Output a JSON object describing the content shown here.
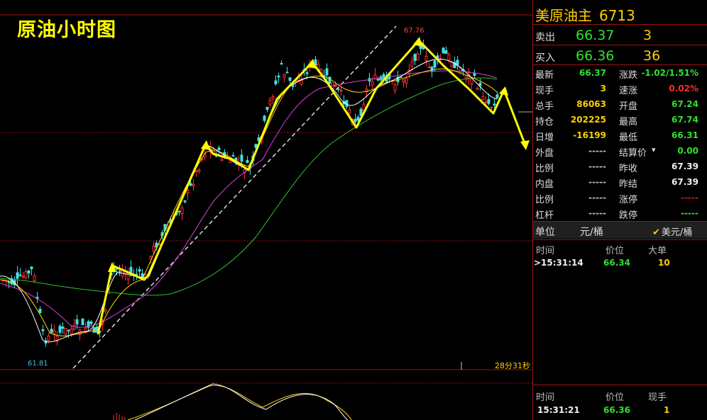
{
  "chart": {
    "title": "原油小时图",
    "high_label": "67.76",
    "low_label": "61.81",
    "countdown": "28分31秒"
  },
  "panel": {
    "name": "美原油主",
    "code": "6713",
    "sell": {
      "label": "卖出",
      "price": "66.37",
      "volume": "3"
    },
    "buy": {
      "label": "买入",
      "price": "66.36",
      "volume": "36"
    },
    "left_stats": [
      {
        "label": "最新",
        "value": "66.37",
        "color": "#30e030"
      },
      {
        "label": "现手",
        "value": "3",
        "color": "#ffd000"
      },
      {
        "label": "总手",
        "value": "86063",
        "color": "#ffd000"
      },
      {
        "label": "持仓",
        "value": "202225",
        "color": "#ffd000"
      },
      {
        "label": "日增",
        "value": "-16199",
        "color": "#ffd000"
      },
      {
        "label": "外盘",
        "value": "-----",
        "color": "#bbbbbb"
      },
      {
        "label": "比例",
        "value": "-----",
        "color": "#bbbbbb"
      },
      {
        "label": "内盘",
        "value": "-----",
        "color": "#bbbbbb"
      },
      {
        "label": "比例",
        "value": "-----",
        "color": "#bbbbbb"
      },
      {
        "label": "杠杆",
        "value": "-----",
        "color": "#bbbbbb"
      }
    ],
    "right_stats": [
      {
        "label": "涨跌",
        "value": "-1.02/1.51%",
        "color": "#30e030"
      },
      {
        "label": "速涨",
        "value": "0.02%",
        "color": "#ff3030"
      },
      {
        "label": "开盘",
        "value": "67.24",
        "color": "#30e030"
      },
      {
        "label": "最高",
        "value": "67.74",
        "color": "#30e030"
      },
      {
        "label": "最低",
        "value": "66.31",
        "color": "#30e030"
      },
      {
        "label": "结算价",
        "value": "0.00",
        "color": "#30e030"
      },
      {
        "label": "昨收",
        "value": "67.39",
        "color": "#f0f0f0"
      },
      {
        "label": "昨结",
        "value": "67.39",
        "color": "#f0f0f0"
      },
      {
        "label": "涨停",
        "value": "-----",
        "color": "#c02020"
      },
      {
        "label": "跌停",
        "value": "-----",
        "color": "#30e030"
      }
    ],
    "unit": {
      "label": "单位",
      "value": "元/桶",
      "option": "美元/桶"
    },
    "ticks_table": {
      "headers": [
        "时间",
        "价位",
        "大单"
      ],
      "rows": [
        {
          "time": ">15:31:14",
          "price": "66.34",
          "size": "10"
        }
      ]
    },
    "trades_table": {
      "headers": [
        "时间",
        "价位",
        "现手"
      ],
      "rows": [
        {
          "time": "15:31:21",
          "price": "66.36",
          "size": "1"
        }
      ]
    }
  },
  "colors": {
    "up": "#ff3030",
    "down": "#40e0e0",
    "trend": "#ffff00",
    "ma_white": "#ffffff",
    "ma_yellow": "#ffd000",
    "ma_magenta": "#e040e0",
    "ma_green": "#30c030"
  }
}
